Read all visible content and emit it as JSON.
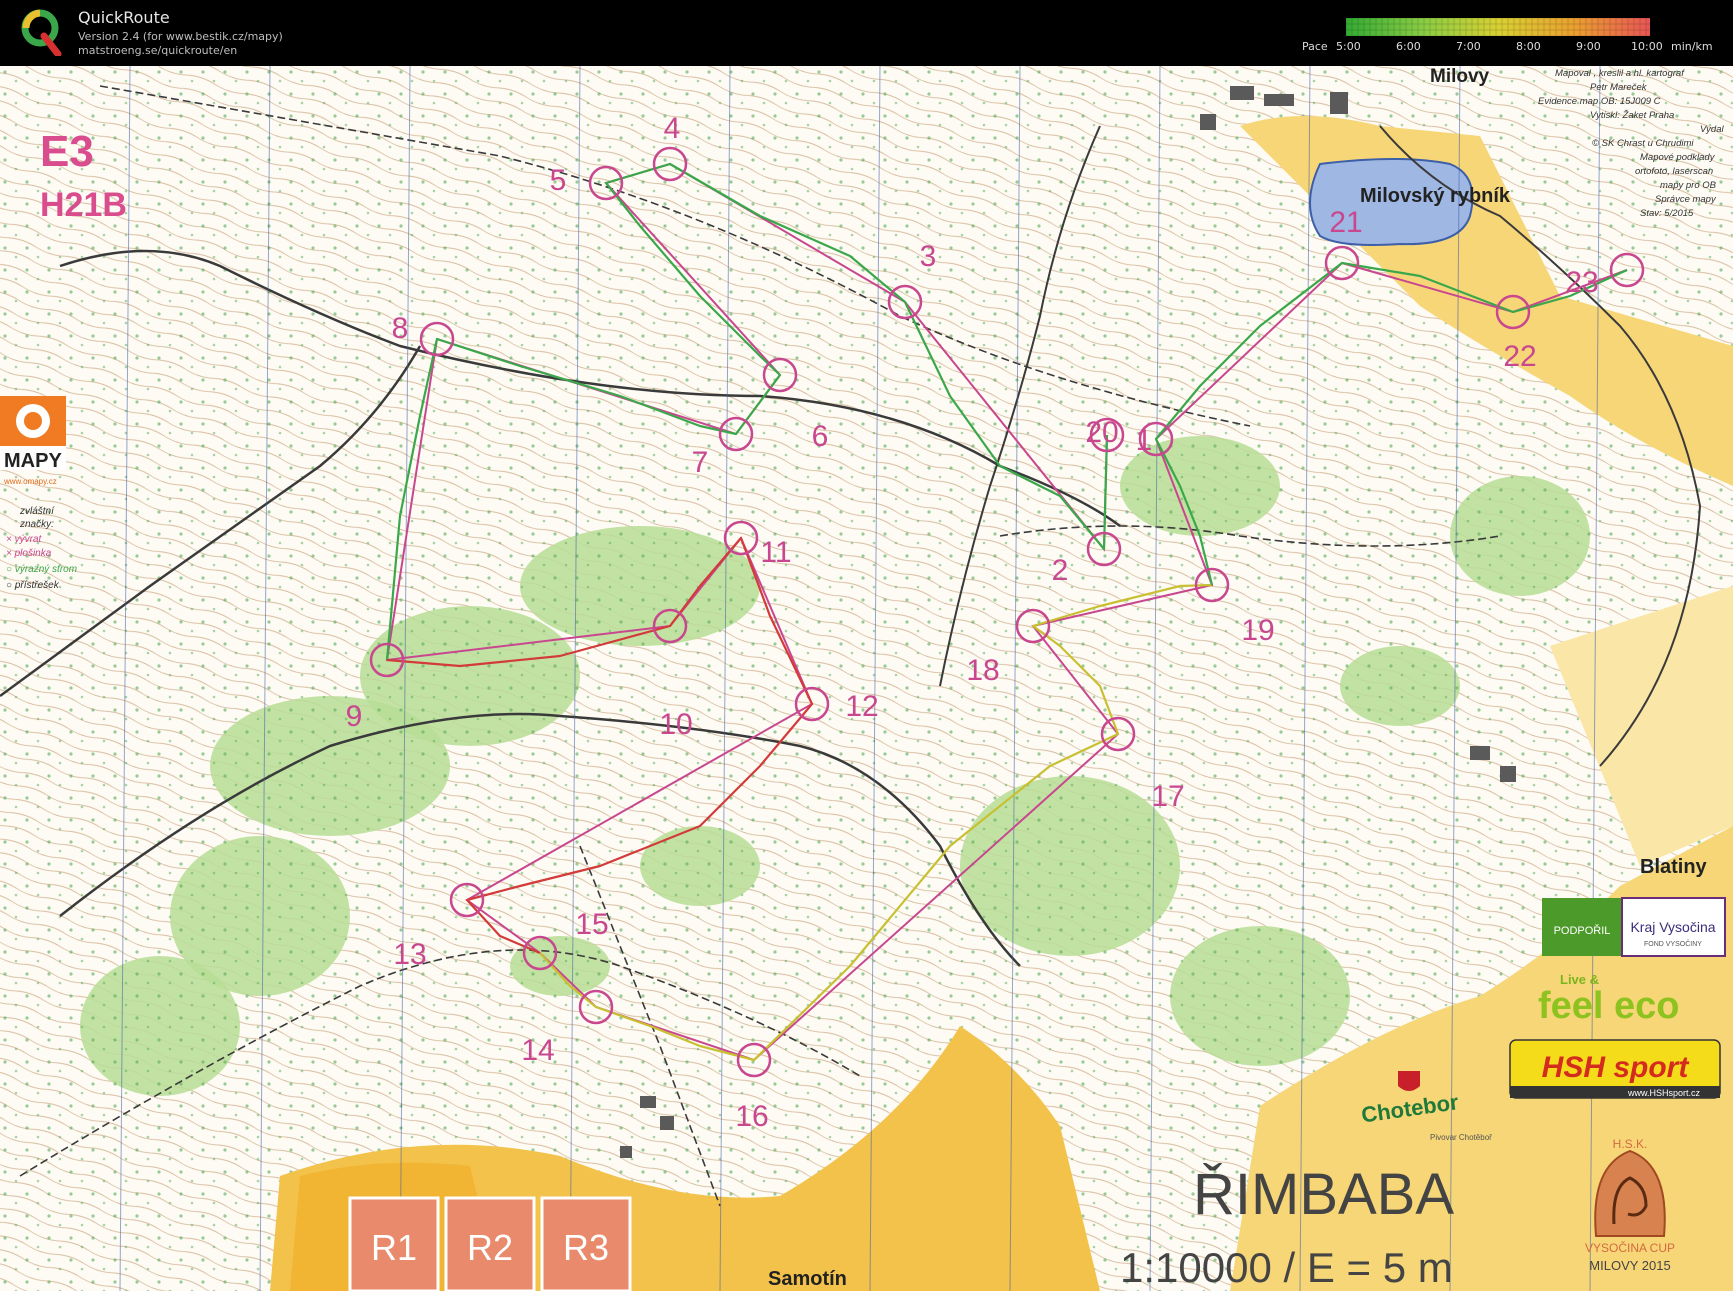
{
  "app": {
    "name": "QuickRoute",
    "version_line": "Version 2.4  (for www.bestik.cz/mapy)",
    "url_line": "matstroeng.se/quickroute/en"
  },
  "pace_scale": {
    "label": "Pace",
    "ticks": [
      "5:00",
      "6:00",
      "7:00",
      "8:00",
      "9:00",
      "10:00"
    ],
    "unit": "min/km",
    "colors": [
      "#33aa33",
      "#88cc44",
      "#cccc33",
      "#e8aa33",
      "#e85555"
    ]
  },
  "map": {
    "class_code": "E3",
    "course": "H21B",
    "lake_name": "Milovský rybník",
    "village_top": "Milovy",
    "village_right": "Blatiny",
    "village_bottom": "Samotín",
    "map_title": "ŘIMBABA",
    "scale_line": "1:10000 / E = 5 m",
    "relay_boxes": [
      "R1",
      "R2",
      "R3"
    ],
    "credits": [
      "Mapoval , kreslil a hl. kartograf",
      "Petr Mareček",
      "Evidence map OB: 15J009 C",
      "Vytiskl: Žaket Praha",
      "Vydal",
      "© SK Chrast u Chrudimi",
      "Mapové podklady",
      "ortofoto, laserscan",
      "mapy pro OB",
      "Správce mapy",
      "Stav: 5/2015"
    ],
    "legend": [
      "zvláštní",
      "značky:",
      "× vývrat",
      "× plošinka",
      "○ výrazný strom",
      "○ přístřešek"
    ],
    "omapy": {
      "name": "MAPY",
      "url": "www.omapy.cz"
    },
    "sponsors": {
      "podporil": "PODPOŘIL",
      "kraj": "Kraj Vysočina",
      "fond": "FOND VYSOČINY",
      "feel_small": "Live &",
      "feel_big": "feel eco",
      "hsh": "HSH sport",
      "hsh_url": "www.HSHsport.cz",
      "chotebor": "Chotebor",
      "chotebor_sub": "Pivovar Chotěboř",
      "hsk": "H.S.K.",
      "cup": "VYSOČINA CUP",
      "cup_place": "MILOVY 2015"
    }
  },
  "controls": [
    {
      "label": "1"
    },
    {
      "label": "2"
    },
    {
      "label": "3"
    },
    {
      "label": "4"
    },
    {
      "label": "5"
    },
    {
      "label": "6"
    },
    {
      "label": "7"
    },
    {
      "label": "8"
    },
    {
      "label": "9"
    },
    {
      "label": "10"
    },
    {
      "label": "11"
    },
    {
      "label": "12"
    },
    {
      "label": "13"
    },
    {
      "label": "14"
    },
    {
      "label": "15"
    },
    {
      "label": "16"
    },
    {
      "label": "17"
    },
    {
      "label": "18"
    },
    {
      "label": "19"
    },
    {
      "label": "20"
    },
    {
      "label": "21"
    },
    {
      "label": "22"
    },
    {
      "label": "23"
    }
  ]
}
